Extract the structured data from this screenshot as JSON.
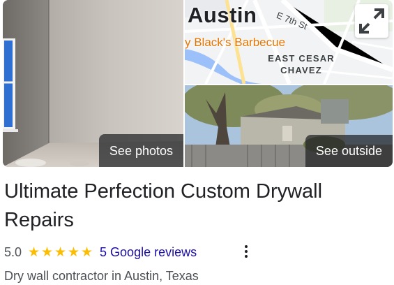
{
  "photos": {
    "see_photos_label": "See photos",
    "see_outside_label": "See outside"
  },
  "map": {
    "city_label": "Austin",
    "street_label": "E 7th St",
    "poi_label": "y Black's Barbecue",
    "area_label": "EAST CESAR CHAVEZ",
    "expand_icon": "expand-icon"
  },
  "business": {
    "name": "Ultimate Perfection Custom Drywall Repairs",
    "rating": "5.0",
    "stars": 5,
    "reviews_link": "5 Google reviews",
    "category": "Dry wall contractor in Austin, Texas"
  },
  "colors": {
    "star": "#fbbc04",
    "link": "#1a0dab",
    "poi": "#e37400"
  }
}
